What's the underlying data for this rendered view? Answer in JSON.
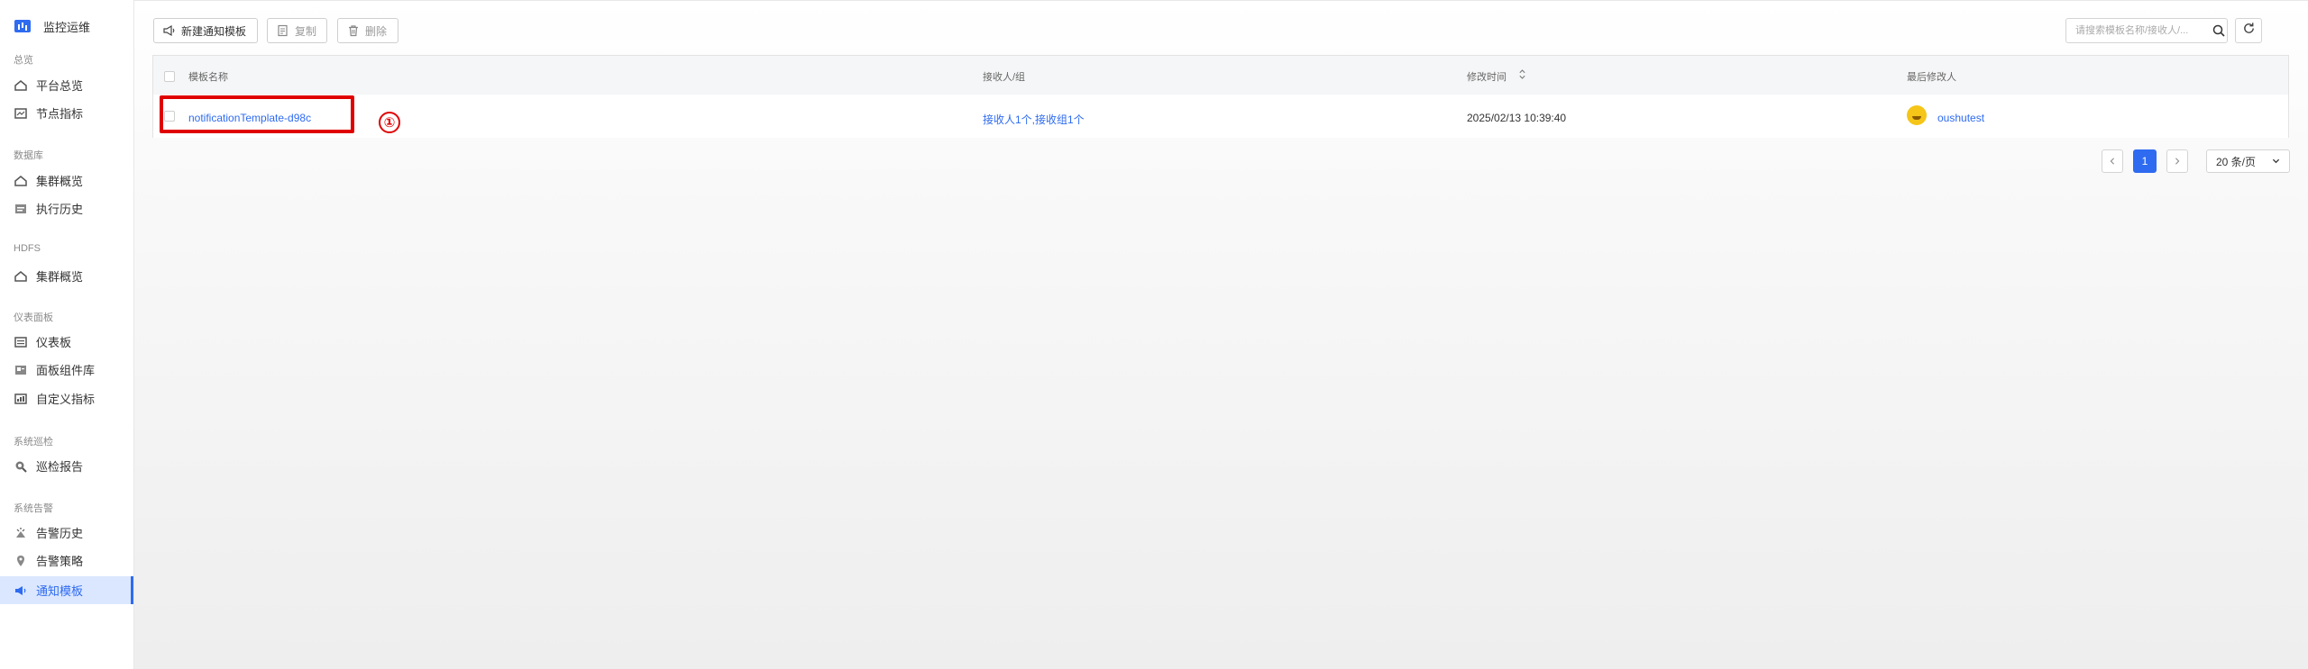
{
  "sidebar": {
    "brand": "监控运维",
    "groups": [
      {
        "title": "总览",
        "items": [
          "平台总览",
          "节点指标"
        ]
      },
      {
        "title": "数据库",
        "items": [
          "集群概览",
          "执行历史"
        ]
      },
      {
        "title": "HDFS",
        "items": [
          "集群概览"
        ]
      },
      {
        "title": "仪表面板",
        "items": [
          "仪表板",
          "面板组件库",
          "自定义指标"
        ]
      },
      {
        "title": "系统巡检",
        "items": [
          "巡检报告"
        ]
      },
      {
        "title": "系统告警",
        "items": [
          "告警历史",
          "告警策略",
          "通知模板"
        ]
      }
    ],
    "active_item": "通知模板"
  },
  "toolbar": {
    "new_label": "新建通知模板",
    "copy_label": "复制",
    "delete_label": "删除",
    "search_placeholder": "请搜索模板名称/接收人/..."
  },
  "table": {
    "columns": [
      "模板名称",
      "接收人/组",
      "修改时间",
      "最后修改人"
    ],
    "rows": [
      {
        "name": "notificationTemplate-d98c",
        "receivers": "接收人1个,接收组1个",
        "modified_time": "2025/02/13 10:39:40",
        "modifier": "oushutest"
      }
    ]
  },
  "annotation": {
    "marker": "①",
    "color": "#e00000"
  },
  "pagination": {
    "current": "1",
    "page_size": "20 条/页"
  },
  "colors": {
    "accent": "#2e6bf0",
    "highlight": "#e00000"
  }
}
